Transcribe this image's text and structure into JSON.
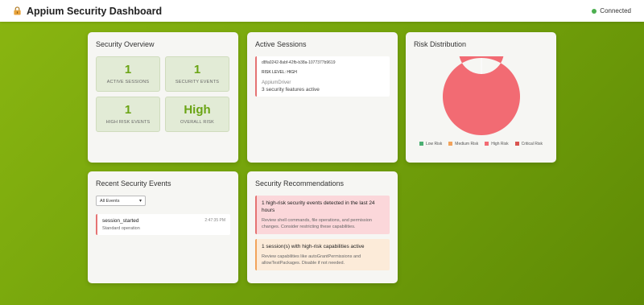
{
  "app": {
    "title": "Appium Security Dashboard",
    "status": "Connected"
  },
  "overview": {
    "title": "Security Overview",
    "stats": [
      {
        "value": "1",
        "label": "ACTIVE SESSIONS"
      },
      {
        "value": "1",
        "label": "SECURITY EVENTS"
      },
      {
        "value": "1",
        "label": "HIGH RISK EVENTS"
      },
      {
        "value": "High",
        "label": "OVERALL RISK"
      }
    ]
  },
  "sessions": {
    "title": "Active Sessions",
    "items": [
      {
        "id": "d8fa0242-8abf-42fb-b38a-1077377b9619",
        "risk": "RISK LEVEL: HIGH",
        "driver": "AppiumDriver",
        "features": "3 security features active"
      }
    ]
  },
  "risk": {
    "title": "Risk Distribution",
    "legend": [
      {
        "label": "Low Risk",
        "color": "#4caf73"
      },
      {
        "label": "Medium Risk",
        "color": "#f2a35b"
      },
      {
        "label": "High Risk",
        "color": "#f26b73"
      },
      {
        "label": "Critical Risk",
        "color": "#d9534f"
      }
    ]
  },
  "chart_data": {
    "type": "pie",
    "categories": [
      "Low Risk",
      "Medium Risk",
      "High Risk",
      "Critical Risk"
    ],
    "values": [
      0,
      0,
      1,
      0
    ],
    "colors": [
      "#4caf73",
      "#f2a35b",
      "#f26b73",
      "#d9534f"
    ],
    "legend": "bottom"
  },
  "events": {
    "title": "Recent Security Events",
    "filter": "All Events",
    "items": [
      {
        "name": "session_started",
        "desc": "Standard operation",
        "time": "2:47:35 PM"
      }
    ]
  },
  "recommendations": {
    "title": "Security Recommendations",
    "items": [
      {
        "level": "high",
        "title": "1 high-risk security events detected in the last 24 hours",
        "desc": "Review shell commands, file operations, and permission changes. Consider restricting these capabilities."
      },
      {
        "level": "medium",
        "title": "1 session(s) with high-risk capabilities active",
        "desc": "Review capabilities like autoGrantPermissions and allowTestPackages. Disable if not needed."
      }
    ]
  }
}
